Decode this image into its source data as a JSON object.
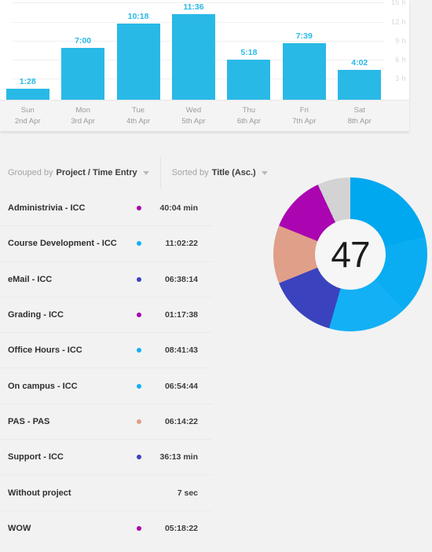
{
  "chart_data": [
    {
      "type": "bar",
      "title": "",
      "xlabel": "",
      "ylabel": "",
      "ylim": [
        0,
        15
      ],
      "grid": true,
      "y_ticks": [
        "3 h",
        "6 h",
        "9 h",
        "12 h",
        "15 h"
      ],
      "y_tick_values": [
        3,
        6,
        9,
        12,
        15
      ],
      "bar_color": "#29b9e7",
      "categories": [
        "Sun",
        "Mon",
        "Tue",
        "Wed",
        "Thu",
        "Fri",
        "Sat"
      ],
      "category_dates": [
        "2nd Apr",
        "3rd Apr",
        "4th Apr",
        "5th Apr",
        "6th Apr",
        "7th Apr",
        "8th Apr"
      ],
      "value_labels": [
        "1:28",
        "7:00",
        "10:18",
        "11:36",
        "5:18",
        "7:39",
        "4:02"
      ],
      "values": [
        1.47,
        7.0,
        10.3,
        11.6,
        5.3,
        7.65,
        4.03
      ]
    },
    {
      "type": "pie",
      "title": "",
      "center_label": "47",
      "labels": [
        "Course Development - ICC",
        "Office Hours - ICC",
        "On campus - ICC",
        "eMail - ICC",
        "PAS - PAS",
        "Grading - ICC",
        "Without project"
      ],
      "values": [
        27.5,
        16.5,
        14.0,
        12.5,
        10.5,
        12.0,
        7.0
      ],
      "colors": [
        "#00a8f0",
        "#00a8f0",
        "#14b0f5",
        "#3a43bd",
        "#e09f88",
        "#aa05b0",
        "#d3d3d3"
      ]
    }
  ],
  "chart": {
    "y_ticks": [
      {
        "label": "15 h",
        "top_pct": 2
      },
      {
        "label": "12 h",
        "top_pct": 22
      },
      {
        "label": "9 h",
        "top_pct": 41
      },
      {
        "label": "6 h",
        "top_pct": 60
      },
      {
        "label": "3 h",
        "top_pct": 79
      }
    ],
    "bars": [
      {
        "day": "Sun",
        "date": "2nd Apr",
        "label": "1:28",
        "height_pct": 11
      },
      {
        "day": "Mon",
        "date": "3rd Apr",
        "label": "7:00",
        "height_pct": 52
      },
      {
        "day": "Tue",
        "date": "4th Apr",
        "label": "10:18",
        "height_pct": 76
      },
      {
        "day": "Wed",
        "date": "5th Apr",
        "label": "11:36",
        "height_pct": 86
      },
      {
        "day": "Thu",
        "date": "6th Apr",
        "label": "5:18",
        "height_pct": 40
      },
      {
        "day": "Fri",
        "date": "7th Apr",
        "label": "7:39",
        "height_pct": 57
      },
      {
        "day": "Sat",
        "date": "8th Apr",
        "label": "4:02",
        "height_pct": 30
      }
    ]
  },
  "toolbar": {
    "grouped": {
      "prefix": "Grouped by",
      "value": "Project / Time Entry"
    },
    "sorted": {
      "prefix": "Sorted by",
      "value": "Title (Asc.)"
    }
  },
  "list": {
    "rows": [
      {
        "title": "Administrivia - ICC",
        "color": "#aa05b0",
        "duration": "40:04 min"
      },
      {
        "title": "Course Development - ICC",
        "color": "#14b0f5",
        "duration": "11:02:22"
      },
      {
        "title": "eMail - ICC",
        "color": "#3a43bd",
        "duration": "06:38:14"
      },
      {
        "title": "Grading - ICC",
        "color": "#aa05b0",
        "duration": "01:17:38"
      },
      {
        "title": "Office Hours - ICC",
        "color": "#14b0f5",
        "duration": "08:41:43"
      },
      {
        "title": "On campus - ICC",
        "color": "#14b0f5",
        "duration": "06:54:44"
      },
      {
        "title": "PAS - PAS",
        "color": "#e09f88",
        "duration": "06:14:22"
      },
      {
        "title": "Support - ICC",
        "color": "#3a43bd",
        "duration": "36:13 min"
      },
      {
        "title": "Without project",
        "color": "",
        "duration": "7 sec"
      },
      {
        "title": "WOW",
        "color": "#aa05b0",
        "duration": "05:18:22"
      }
    ]
  },
  "donut": {
    "center": "47",
    "gradient": "conic-gradient(#00a8f0 0deg 76deg, #00a8f0 76deg 76.7deg, #0aadf2 76.7deg 136deg, #14b0f5 136deg 196deg, #3a43bd 196deg 248deg, #e09f88 248deg 292deg, #aa05b0 292deg 335deg, #d3d3d3 335deg 360deg)"
  }
}
